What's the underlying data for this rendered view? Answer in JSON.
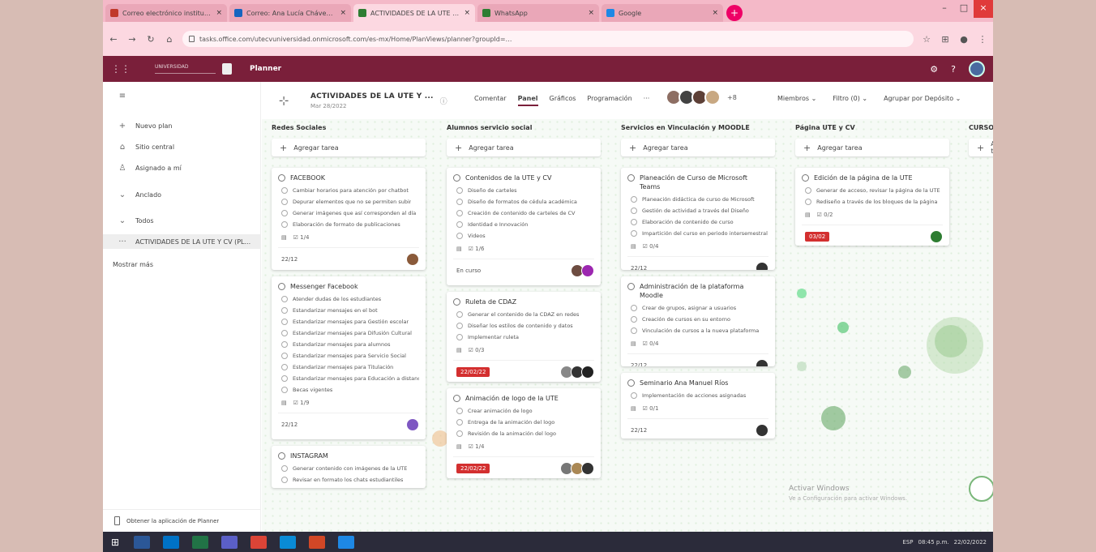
{
  "browser": {
    "tabs": [
      {
        "title": "Correo electrónico institucional",
        "active": false,
        "fav": "#c0392b"
      },
      {
        "title": "Correo: Ana Lucía Chávez Escobar",
        "active": false,
        "fav": "#1565c0"
      },
      {
        "title": "ACTIVIDADES DE LA UTE Y CV",
        "active": true,
        "fav": "#2e7d32"
      },
      {
        "title": "WhatsApp",
        "active": false,
        "fav": "#2e7d32"
      },
      {
        "title": "Google",
        "active": false,
        "fav": "#1e88e5"
      }
    ],
    "close_glyph": "×",
    "new_tab_glyph": "+",
    "url": "tasks.office.com/utecvuniversidad.onmicrosoft.com/es-mx/Home/PlanViews/planner?groupId=…"
  },
  "app": {
    "name": "Planner",
    "logo_text": "UNIVERSIDAD"
  },
  "sidebar": {
    "items": [
      {
        "label": "Nuevo plan",
        "icon": "plus-icon"
      },
      {
        "label": "Sitio central",
        "icon": "home-icon"
      },
      {
        "label": "Asignado a mí",
        "icon": "user-icon"
      },
      {
        "label": "Anclado",
        "icon": "chevron-down-icon"
      },
      {
        "label": "Todos",
        "icon": "chevron-down-icon"
      },
      {
        "label": "ACTIVIDADES DE LA UTE Y CV (PL...",
        "icon": "plan-icon"
      },
      {
        "label": "Mostrar más",
        "icon": ""
      }
    ],
    "footer": "Obtener la aplicación de Planner"
  },
  "plan": {
    "title": "ACTIVIDADES DE LA UTE Y ...",
    "date": "Mar 28/2022",
    "view_tabs": [
      "Comentar",
      "Panel",
      "Gráficos",
      "Programación",
      "···"
    ],
    "active_tab": "Panel",
    "members_more": "+8",
    "filters": [
      "Miembros ⌄",
      "Filtro (0) ⌄",
      "Agrupar por Depósito ⌄"
    ]
  },
  "add_task_label": "Agregar tarea",
  "columns": [
    {
      "name": "Redes Sociales",
      "cards": [
        {
          "title": "FACEBOOK",
          "checks": [
            "Cambiar horarios para atención por chatbot",
            "Depurar elementos que no se permiten subir",
            "Generar imágenes que así corresponden al día",
            "Elaboración de formato de publicaciones"
          ],
          "meta": "☑ 1/4",
          "due": "22/12",
          "late": false,
          "avatars": [
            "#8a5a3a"
          ]
        },
        {
          "title": "Messenger Facebook",
          "checks": [
            "Atender dudas de los estudiantes",
            "Estandarizar mensajes en el bot",
            "Estandarizar mensajes para Gestión escolar",
            "Estandarizar mensajes para Difusión Cultural",
            "Estandarizar mensajes para alumnos",
            "Estandarizar mensajes para Servicio Social",
            "Estandarizar mensajes para Titulación",
            "Estandarizar mensajes para Educación a distancia",
            "Becas vigentes"
          ],
          "meta": "☑ 1/9",
          "due": "22/12",
          "late": false,
          "avatars": [
            "#7e57c2"
          ]
        },
        {
          "title": "INSTAGRAM",
          "checks": [
            "Generar contenido con imágenes de la UTE",
            "Revisar en formato los chats estudiantiles"
          ],
          "meta": "",
          "due": "",
          "late": false,
          "avatars": []
        }
      ]
    },
    {
      "name": "Alumnos servicio social",
      "cards": [
        {
          "title": "Contenidos de la UTE y CV",
          "checks": [
            "Diseño de carteles",
            "Diseño de formatos de cédula académica",
            "Creación de contenido de carteles de CV",
            "Identidad e Innovación",
            "Videos"
          ],
          "meta": "☑ 1/6",
          "due": "En curso",
          "late": false,
          "avatars": [
            "#6d4c41",
            "#9c27b0"
          ]
        },
        {
          "title": "Ruleta de CDAZ",
          "checks": [
            "Generar el contenido de la CDAZ en redes",
            "Diseñar los estilos de contenido y datos",
            "Implementar ruleta"
          ],
          "meta": "☑ 0/3",
          "due": "22/02/22",
          "late": true,
          "avatars": [
            "#888",
            "#333",
            "#222"
          ]
        },
        {
          "title": "Animación de logo de la UTE",
          "checks": [
            "Crear animación de logo",
            "Entrega de la animación del logo",
            "Revisión de la animación del logo"
          ],
          "meta": "☑ 1/4",
          "due": "22/02/22",
          "late": true,
          "avatars": [
            "#777",
            "#aa8855",
            "#333"
          ]
        }
      ]
    },
    {
      "name": "Servicios en Vinculación y MOODLE",
      "cards": [
        {
          "title": "Planeación de Curso de Microsoft Teams",
          "checks": [
            "Planeación didáctica de curso de Microsoft",
            "Gestión de actividad a través del Diseño",
            "Elaboración de contenido de curso",
            "Impartición del curso en periodo intersemestral"
          ],
          "meta": "☑ 0/4",
          "due": "22/12",
          "late": false,
          "avatars": [
            "#333"
          ]
        },
        {
          "title": "Administración de la plataforma Moodle",
          "checks": [
            "Crear de grupos, asignar a usuarios",
            "Creación de cursos en su entorno",
            "Vinculación de cursos a la nueva plataforma"
          ],
          "meta": "☑ 0/4",
          "due": "22/12",
          "late": false,
          "avatars": [
            "#333"
          ]
        },
        {
          "title": "Seminario Ana Manuel Ríos",
          "checks": [
            "Implementación de acciones asignadas"
          ],
          "meta": "☑ 0/1",
          "due": "22/12",
          "late": false,
          "avatars": [
            "#333"
          ]
        }
      ]
    },
    {
      "name": "Página UTE y CV",
      "cards": [
        {
          "title": "Edición de la página de la UTE",
          "checks": [
            "Generar de acceso, revisar la página de la UTE",
            "Rediseño a través de los bloques de la página"
          ],
          "meta": "☑ 0/2",
          "due": "03/02",
          "late": true,
          "avatars": [
            "#2e7d32"
          ]
        }
      ]
    },
    {
      "name": "CURSOS",
      "cards": []
    }
  ],
  "watermark": {
    "title": "Activar Windows",
    "subtitle": "Ve a Configuración para activar Windows."
  },
  "taskbar": {
    "icons": [
      {
        "name": "word-icon",
        "color": "#2b5797"
      },
      {
        "name": "outlook-icon",
        "color": "#0072c6"
      },
      {
        "name": "excel-icon",
        "color": "#217346"
      },
      {
        "name": "teams-icon",
        "color": "#5b5fc7"
      },
      {
        "name": "chrome-icon",
        "color": "#db4437"
      },
      {
        "name": "edge-icon",
        "color": "#0a8bd6"
      },
      {
        "name": "powerpoint-icon",
        "color": "#d24726"
      },
      {
        "name": "store-icon",
        "color": "#1e88e5"
      }
    ],
    "tray": {
      "lang": "ESP",
      "time": "08:45 p.m.",
      "date": "22/02/2022"
    }
  }
}
